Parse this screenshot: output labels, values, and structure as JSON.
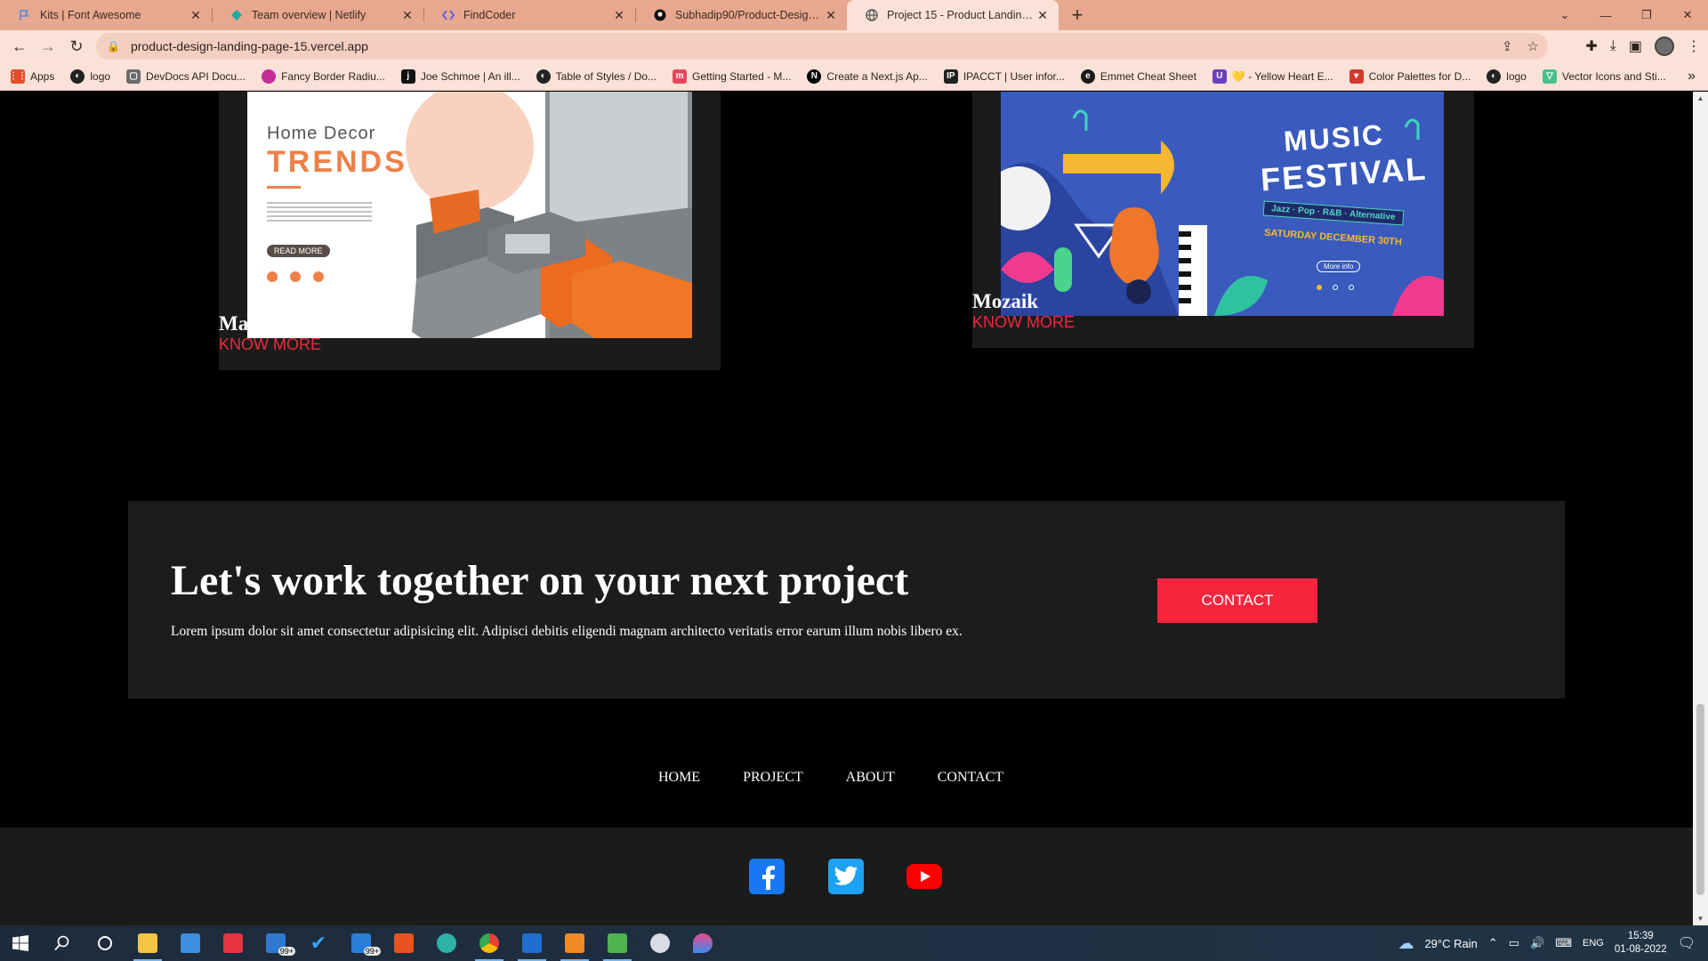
{
  "browser": {
    "tabs": [
      {
        "title": "Kits | Font Awesome",
        "icon": "flag-icon",
        "color": "#528dd7"
      },
      {
        "title": "Team overview | Netlify",
        "icon": "netlify-icon",
        "color": "#20a7a0"
      },
      {
        "title": "FindCoder",
        "icon": "findcoder-icon",
        "color": "#5a5ce0"
      },
      {
        "title": "Subhadip90/Product-Design-Lan",
        "icon": "github-icon",
        "color": "#111111"
      },
      {
        "title": "Project 15 - Product Landing Pag",
        "icon": "globe-icon",
        "color": "#555555"
      }
    ],
    "url": "product-design-landing-page-15.vercel.app",
    "bookmarks": [
      {
        "label": "Apps",
        "color": "#e34c26"
      },
      {
        "label": "logo",
        "color": "#222222"
      },
      {
        "label": "DevDocs API Docu...",
        "color": "#6b6b6b"
      },
      {
        "label": "Fancy Border Radiu...",
        "color": "#c42c9a"
      },
      {
        "label": "Joe Schmoe | An ill...",
        "color": "#111111"
      },
      {
        "label": "Table of Styles / Do...",
        "color": "#222222"
      },
      {
        "label": "Getting Started - M...",
        "color": "#e8475a"
      },
      {
        "label": "Create a Next.js Ap...",
        "color": "#000000"
      },
      {
        "label": "IPACCT | User infor...",
        "color": "#222222"
      },
      {
        "label": "Emmet Cheat Sheet",
        "color": "#1a1a1a"
      },
      {
        "label": "💛 - Yellow Heart E...",
        "color": "#6a3fc2"
      },
      {
        "label": "Color Palettes for D...",
        "color": "#d23a2d"
      },
      {
        "label": "logo",
        "color": "#222222"
      },
      {
        "label": "Vector Icons and Sti...",
        "color": "#46c08c"
      }
    ]
  },
  "projects": [
    {
      "title": "Macro Accent",
      "link": "KNOW MORE",
      "image": {
        "heading": "Home Decor",
        "subheading": "TRENDS",
        "button": "READ MORE"
      }
    },
    {
      "title": "Mozaik",
      "link": "KNOW MORE",
      "image": {
        "heading": "MUSIC",
        "subheading": "FESTIVAL",
        "genres": "Jazz · Pop · R&B · Alternative",
        "date": "SATURDAY DECEMBER 30TH",
        "button": "More info"
      }
    }
  ],
  "cta": {
    "heading": "Let's work together on your next project",
    "body": "Lorem ipsum dolor sit amet consectetur adipisicing elit. Adipisci debitis eligendi magnam architecto veritatis error earum illum nobis libero ex.",
    "button": "CONTACT"
  },
  "footer": {
    "nav": [
      "HOME",
      "PROJECT",
      "ABOUT",
      "CONTACT"
    ],
    "social": [
      {
        "icon": "facebook-icon",
        "color": "#1877f2"
      },
      {
        "icon": "twitter-icon",
        "color": "#1da1f2"
      },
      {
        "icon": "youtube-icon",
        "color": "#ff0000"
      }
    ]
  },
  "taskbar": {
    "weather": "29°C  Rain",
    "language": "ENG",
    "time": "15:39",
    "date": "01-08-2022",
    "badges": [
      "99+",
      "99+"
    ]
  },
  "colors": {
    "accent": "#f7263d",
    "card": "#1b1b1b",
    "page": "#000000"
  }
}
